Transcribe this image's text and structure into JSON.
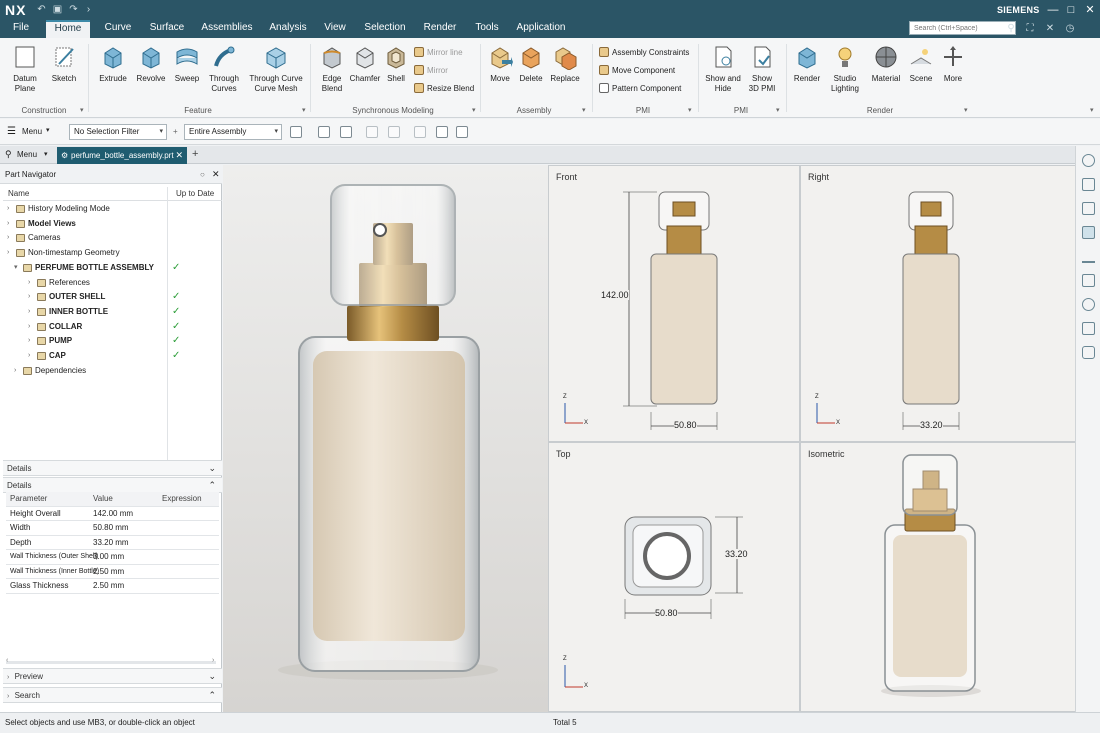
{
  "app": {
    "logo": "NX",
    "brand": "SIEMENS"
  },
  "menu": {
    "tabs": [
      "File",
      "Home",
      "Curve",
      "Surface",
      "Assemblies",
      "Analysis",
      "View",
      "Selection",
      "Render",
      "Tools",
      "Application"
    ],
    "active": "Home",
    "search_placeholder": "Search (Ctrl+Space)"
  },
  "ribbon": {
    "construction": {
      "datum_plane": "Datum\nPlane",
      "sketch": "Sketch",
      "label": "Construction"
    },
    "feature": {
      "extrude": "Extrude",
      "revolve": "Revolve",
      "sweep": "Sweep",
      "through_curves": "Through\nCurves",
      "through_curve_mesh": "Through Curve\nCurve Mesh",
      "label": "Feature"
    },
    "sync": {
      "edge_blend": "Edge\nBlend",
      "chamfer": "Chamfer",
      "shell": "Shell",
      "mirror_line": "Mirror line",
      "mirror": "Mirror",
      "resize_blend": "Resize Blend",
      "label": "Synchronous Modeling"
    },
    "assembly": {
      "move": "Move",
      "delete": "Delete",
      "replace": "Replace",
      "label": "Assembly"
    },
    "assembly_pmi": {
      "constraints": "Assembly Constraints",
      "move_component": "Move Component",
      "pattern_component": "Pattern Component",
      "label": "PMI"
    },
    "pmi": {
      "show_hide": "Show and\nHide",
      "show_3d": "Show\n3D PMI",
      "label": "PMI"
    },
    "render": {
      "render": "Render",
      "studio_lighting": "Studio\nLighting",
      "material": "Material",
      "scene": "Scene",
      "more": "More",
      "label": "Render"
    }
  },
  "selbar": {
    "menu": "Menu",
    "filter": "No Selection Filter",
    "scope": "Entire Assembly"
  },
  "tabbar": {
    "menu": "Menu",
    "file_tab": "perfume_bottle_assembly.prt"
  },
  "navigator": {
    "title": "Part Navigator",
    "col_name": "Name",
    "col_status": "Up to Date",
    "rows": [
      {
        "label": "History Modeling Mode",
        "indent": 0,
        "check": false
      },
      {
        "label": "Model Views",
        "indent": 0,
        "check": false,
        "bold": true
      },
      {
        "label": "Cameras",
        "indent": 0,
        "check": false
      },
      {
        "label": "Non-timestamp Geometry",
        "indent": 0,
        "check": false
      },
      {
        "label": "PERFUME BOTTLE ASSEMBLY",
        "indent": 1,
        "check": true,
        "bold": true
      },
      {
        "label": "References",
        "indent": 2,
        "check": false
      },
      {
        "label": "OUTER SHELL",
        "indent": 2,
        "check": true,
        "bold": true
      },
      {
        "label": "INNER BOTTLE",
        "indent": 2,
        "check": true,
        "bold": true
      },
      {
        "label": "COLLAR",
        "indent": 2,
        "check": true,
        "bold": true
      },
      {
        "label": "PUMP",
        "indent": 2,
        "check": true,
        "bold": true
      },
      {
        "label": "CAP",
        "indent": 2,
        "check": true,
        "bold": true
      },
      {
        "label": "Dependencies",
        "indent": 1,
        "check": false
      }
    ],
    "details_collapsed": "Details",
    "details_label": "Details",
    "details_headers": [
      "Parameter",
      "Value",
      "Expression"
    ],
    "details_rows": [
      [
        "Height Overall",
        "142.00 mm",
        ""
      ],
      [
        "Width",
        "50.80 mm",
        ""
      ],
      [
        "Depth",
        "33.20 mm",
        ""
      ],
      [
        "Wall Thickness (Outer Shell)",
        "3.00 mm",
        ""
      ],
      [
        "Wall Thickness (Inner Bottle)",
        "2.50 mm",
        ""
      ],
      [
        "Glass Thickness",
        "2.50 mm",
        ""
      ]
    ],
    "preview": "Preview",
    "search": "Search"
  },
  "views": {
    "front": {
      "label": "Front",
      "height": "142.00",
      "width": "50.80"
    },
    "right": {
      "label": "Right",
      "depth": "33.20"
    },
    "top": {
      "label": "Top",
      "width": "50.80",
      "depth": "33.20"
    },
    "iso": {
      "label": "Isometric"
    },
    "axis_x": "X",
    "axis_z": "Z"
  },
  "status": {
    "message": "Select objects and use MB3, or double-click an object",
    "total": "Total 5"
  },
  "colors": {
    "brand": "#2b5566",
    "accent": "#1f5c70",
    "gold": "#b58c45",
    "liquid": "#e7dccb",
    "check": "#2e9e3a"
  }
}
